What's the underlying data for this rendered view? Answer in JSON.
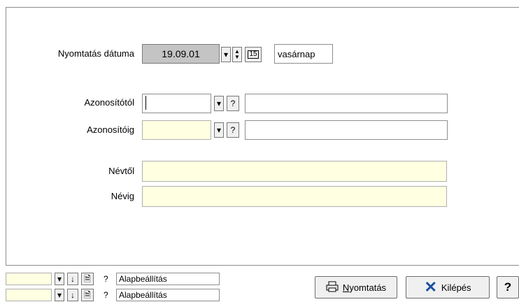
{
  "form": {
    "print_date_label": "Nyomtatás dátuma",
    "print_date_value": "19.09.01",
    "day_name": "vasárnap",
    "id_from_label": "Azonosítótól",
    "id_to_label": "Azonosítóig",
    "name_from_label": "Névtől",
    "name_to_label": "Névig",
    "lookup_glyph": "?",
    "dropdown_glyph": "▾",
    "calendar_glyph": "15"
  },
  "footer": {
    "preset_1": "Alapbeállítás",
    "preset_2": "Alapbeállítás",
    "down_glyph": "↓",
    "help_glyph": "?",
    "print_label_rest": "yomtatás",
    "print_label_accel": "N",
    "exit_label": "Kilépés",
    "help_button_label": "?"
  },
  "icons": {
    "dropdown": "chevron-down-icon",
    "spin": "spinner-arrows-icon",
    "calendar": "calendar-icon",
    "printer": "printer-icon",
    "close": "red-x-icon",
    "document": "document-icon",
    "down": "arrow-down-icon"
  },
  "colors": {
    "date_bg": "#c4c4c4",
    "yellow_field": "#ffffe1",
    "exit_icon": "#1b4fa3"
  }
}
